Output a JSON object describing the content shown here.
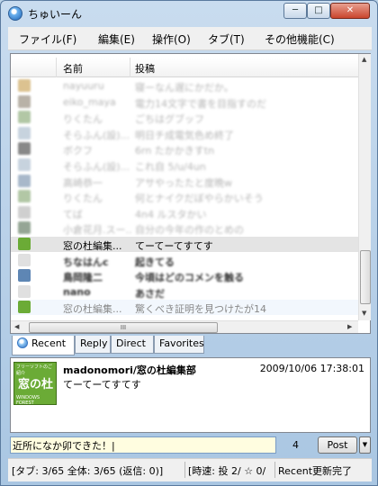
{
  "window": {
    "title": "ちゅいーん",
    "min_label": "─",
    "max_label": "□",
    "close_label": "✕"
  },
  "menu": [
    "ファイル(F)",
    "編集(E)",
    "操作(O)",
    "タブ(T)",
    "その他機能(C)"
  ],
  "columns": {
    "name": "名前",
    "post": "投稿"
  },
  "rows": [
    {
      "name": "nayuuru",
      "post": "寝ーなん遅にかだか。",
      "style": "blur",
      "avatar": "#c59a48"
    },
    {
      "name": "eiko_maya",
      "post": "電力14文字で書を目指すのだ",
      "style": "blur",
      "avatar": "#8a7f6e"
    },
    {
      "name": "りくたん",
      "post": "ごちはグブッフ",
      "style": "blur",
      "avatar": "#7fa36b"
    },
    {
      "name": "そらふん(設)...",
      "post": "明日チ成電気色め終了",
      "style": "blur",
      "avatar": "#a3b6c9"
    },
    {
      "name": "ボクフ",
      "post": "6rn たかかきすtn",
      "style": "blur",
      "avatar": "#3a3a3a"
    },
    {
      "name": "そらふん(設)...",
      "post": "これ自 5/u/4un",
      "style": "blur",
      "avatar": "#a3b6c9"
    },
    {
      "name": "高崎恭一",
      "post": "アサやったたと度晩w",
      "style": "blur",
      "avatar": "#6f8aa8"
    },
    {
      "name": "りくたん",
      "post": "何とナイクだぼやらかいそう",
      "style": "blur",
      "avatar": "#7fa36b"
    },
    {
      "name": "てば",
      "post": "4n4 ルスタかい",
      "style": "blur",
      "avatar": "#b0b0b0"
    },
    {
      "name": "小倉花月.スー...",
      "post": "自分の今年の作のとめの",
      "style": "blur",
      "avatar": "#4f6b4f"
    },
    {
      "name": "窓の杜編集...",
      "post": "てーてーてすてす",
      "style": "sel",
      "avatar": "#6bab36"
    },
    {
      "name": "ちなはんc",
      "post": "起きてる",
      "style": "bold",
      "avatar": "#e0e0e0"
    },
    {
      "name": "鳥岡隆二",
      "post": "今頃はどのコメンを触る",
      "style": "bold",
      "avatar": "#5e86b4"
    },
    {
      "name": "nano",
      "post": "あさだ",
      "style": "bold",
      "avatar": "#e0e0e0"
    },
    {
      "name": "窓の杜編集...",
      "post": "驚くべき証明を見つけたが14",
      "style": "light",
      "avatar": "#6bab36"
    }
  ],
  "scroll": {
    "h_grip": "III",
    "left_arrow": "◀",
    "right_arrow": "▶",
    "up_arrow": "▲",
    "down_arrow": "▼"
  },
  "tabs": [
    "Recent",
    "Reply",
    "Direct",
    "Favorites"
  ],
  "detail": {
    "avatar_top": "フリーソフトのご紹介",
    "avatar_main": "窓の杜",
    "avatar_bottom": "WINDOWS FOREST",
    "user": "madonomori/窓の杜編集部",
    "time": "2009/10/06 17:38:01",
    "text": "てーてーてすてす"
  },
  "composer": {
    "value": "近所になか卯できた！|",
    "count": "4",
    "post_label": "Post",
    "drop_label": "▼"
  },
  "status": {
    "tab_info": "[タブ: 3/65 全体: 3/65 (返信: 0)]",
    "speed": "[時速: 投 2/ ☆ 0/",
    "message": "Recent更新完了"
  }
}
